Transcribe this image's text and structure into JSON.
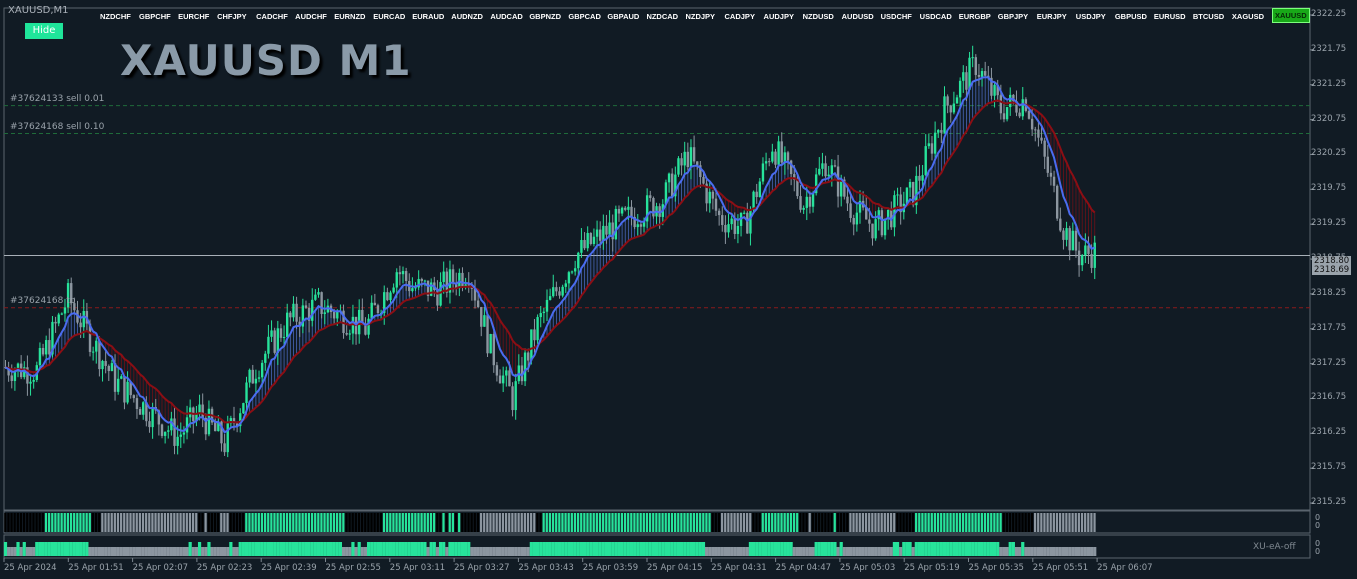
{
  "window": {
    "title": "XAUUSD,M1",
    "hide_label": "Hide",
    "chart_title": "XAUUSD M1"
  },
  "symbols": [
    "NZDCHF",
    "GBPCHF",
    "EURCHF",
    "CHFJPY",
    "CADCHF",
    "AUDCHF",
    "EURNZD",
    "EURCAD",
    "EURAUD",
    "AUDNZD",
    "AUDCAD",
    "GBPNZD",
    "GBPCAD",
    "GBPAUD",
    "NZDCAD",
    "NZDJPY",
    "CADJPY",
    "AUDJPY",
    "NZDUSD",
    "AUDUSD",
    "USDCHF",
    "USDCAD",
    "EURGBP",
    "GBPJPY",
    "EURJPY",
    "USDJPY",
    "GBPUSD",
    "EURUSD",
    "BTCUSD",
    "XAGUSD",
    "XAUUSD"
  ],
  "active_symbol": "XAUUSD",
  "orders": [
    {
      "label": "#37624133 sell 0.01",
      "price": 2320.95,
      "color": "#1f6b3a"
    },
    {
      "label": "#37624168 sell 0.10",
      "price": 2320.55,
      "color": "#1f6b3a"
    },
    {
      "label": "#37624168 tp",
      "price": 2318.05,
      "color": "#8a1b1b"
    }
  ],
  "price_axis": [
    "2322.25",
    "2321.75",
    "2321.25",
    "2320.75",
    "2320.25",
    "2319.75",
    "2319.25",
    "2318.75",
    "2318.25",
    "2317.75",
    "2317.25",
    "2316.75",
    "2316.25",
    "2315.75",
    "2315.25"
  ],
  "current_price": {
    "bid": "2318.80",
    "last": "2318.69",
    "value": 2318.8
  },
  "time_axis": [
    "25 Apr 2024",
    "25 Apr 01:51",
    "25 Apr 02:07",
    "25 Apr 02:23",
    "25 Apr 02:39",
    "25 Apr 02:55",
    "25 Apr 03:11",
    "25 Apr 03:27",
    "25 Apr 03:43",
    "25 Apr 03:59",
    "25 Apr 04:15",
    "25 Apr 04:31",
    "25 Apr 04:47",
    "25 Apr 05:03",
    "25 Apr 05:19",
    "25 Apr 05:35",
    "25 Apr 05:51",
    "25 Apr 06:07"
  ],
  "indicator": {
    "name": "XU-eA-off",
    "zero_a": "0",
    "zero_b": "0",
    "zero_c": "0",
    "zero_d": "0"
  },
  "colors": {
    "bull": "#27e39b",
    "bear": "#8c96a0",
    "ma_fast": "#4a6cf0",
    "ma_slow_down": "#8b0e14",
    "background": "#111b24"
  },
  "chart_data": {
    "type": "candlestick",
    "symbol": "XAUUSD",
    "timeframe": "M1",
    "ylim": [
      2315.15,
      2322.35
    ],
    "close_path": [
      [
        0,
        2317.2
      ],
      [
        10,
        2317.15
      ],
      [
        20,
        2318.2
      ],
      [
        28,
        2317.55
      ],
      [
        35,
        2317.0
      ],
      [
        45,
        2316.6
      ],
      [
        55,
        2316.2
      ],
      [
        62,
        2316.55
      ],
      [
        70,
        2316.1
      ],
      [
        80,
        2317.2
      ],
      [
        90,
        2317.85
      ],
      [
        100,
        2318.1
      ],
      [
        115,
        2317.75
      ],
      [
        125,
        2318.6
      ],
      [
        130,
        2318.35
      ],
      [
        138,
        2318.3
      ],
      [
        148,
        2318.6
      ],
      [
        155,
        2317.45
      ],
      [
        162,
        2316.75
      ],
      [
        170,
        2317.8
      ],
      [
        182,
        2318.8
      ],
      [
        195,
        2319.25
      ],
      [
        210,
        2319.6
      ],
      [
        218,
        2320.25
      ],
      [
        228,
        2319.35
      ],
      [
        236,
        2319.2
      ],
      [
        245,
        2320.4
      ],
      [
        255,
        2319.55
      ],
      [
        262,
        2320.15
      ],
      [
        270,
        2319.5
      ],
      [
        278,
        2319.2
      ],
      [
        290,
        2319.7
      ],
      [
        300,
        2320.9
      ],
      [
        310,
        2321.55
      ],
      [
        318,
        2320.9
      ],
      [
        326,
        2321.05
      ],
      [
        333,
        2320.0
      ],
      [
        338,
        2319.2
      ],
      [
        343,
        2318.8
      ],
      [
        348,
        2318.85
      ]
    ],
    "bar_count": 349,
    "series": [
      {
        "name": "fast MA"
      },
      {
        "name": "slow MA"
      }
    ]
  }
}
